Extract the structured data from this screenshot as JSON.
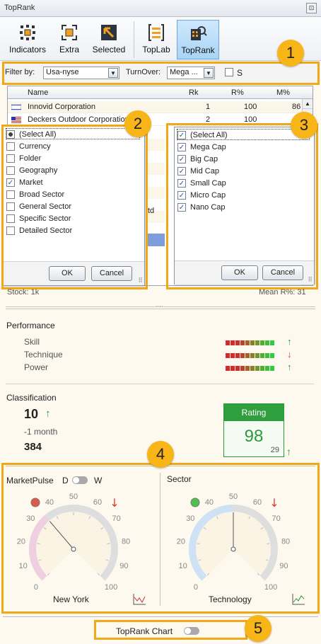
{
  "app_title": "TopRank",
  "pin_glyph": "⊡",
  "toolbar": {
    "items": [
      {
        "label": "Indicators",
        "icon": "indicators-icon"
      },
      {
        "label": "Extra",
        "icon": "extra-icon"
      },
      {
        "label": "Selected",
        "icon": "selected-icon"
      },
      {
        "label": "TopLab",
        "icon": "toplab-icon"
      },
      {
        "label": "TopRank",
        "icon": "toprank-icon",
        "active": true
      }
    ]
  },
  "filter": {
    "filter_by_label": "Filter by:",
    "filter_by_value": "Usa-nyse",
    "turnover_label": "TurnOver:",
    "turnover_value": "Mega ...",
    "s_label": "S"
  },
  "grid": {
    "headers": [
      "Name",
      "Rk",
      "R%",
      "M%"
    ],
    "rows": [
      {
        "name": "Innovid Corporation",
        "rk": "1",
        "r": "100",
        "m": "86"
      },
      {
        "name": "Deckers Outdoor Corporation",
        "rk": "2",
        "r": "100",
        "m": ""
      }
    ],
    "partial_text": "td"
  },
  "list_left": {
    "items": [
      {
        "label": "(Select All)",
        "state": "partial"
      },
      {
        "label": "Currency",
        "state": "off"
      },
      {
        "label": "Folder",
        "state": "off"
      },
      {
        "label": "Geography",
        "state": "off"
      },
      {
        "label": "Market",
        "state": "on"
      },
      {
        "label": "Broad Sector",
        "state": "off"
      },
      {
        "label": "General Sector",
        "state": "off"
      },
      {
        "label": "Specific Sector",
        "state": "off"
      },
      {
        "label": "Detailed Sector",
        "state": "off"
      }
    ],
    "ok": "OK",
    "cancel": "Cancel"
  },
  "list_right": {
    "items": [
      {
        "label": "(Select All)",
        "state": "on"
      },
      {
        "label": "Mega Cap",
        "state": "on"
      },
      {
        "label": "Big Cap",
        "state": "on"
      },
      {
        "label": "Mid Cap",
        "state": "on"
      },
      {
        "label": "Small Cap",
        "state": "on"
      },
      {
        "label": "Micro Cap",
        "state": "on"
      },
      {
        "label": "Nano Cap",
        "state": "on"
      }
    ],
    "ok": "OK",
    "cancel": "Cancel"
  },
  "stats": {
    "stock": "Stock: 1k",
    "mean": "Mean R%: 31"
  },
  "performance": {
    "title": "Performance",
    "rows": [
      {
        "label": "Skill",
        "trend": "up",
        "arrow": "↑"
      },
      {
        "label": "Technique",
        "trend": "down",
        "arrow": "↓"
      },
      {
        "label": "Power",
        "trend": "up",
        "arrow": "↑"
      }
    ],
    "bar_colors": [
      "#d42a2a",
      "#d42a2a",
      "#d42a2a",
      "#b8442a",
      "#a8602a",
      "#8f7b2a",
      "#6f962c",
      "#52ad32",
      "#3cbf3a",
      "#2fcc42"
    ]
  },
  "classification": {
    "title": "Classification",
    "rank": "10",
    "rank_arrow": "↑",
    "period": "-1 month",
    "total": "384"
  },
  "rating": {
    "label": "Rating",
    "value": "98",
    "sub": "29",
    "arrow": "↑"
  },
  "market_pulse": {
    "title": "MarketPulse",
    "toggle_left": "D",
    "toggle_right": "W",
    "light_color": "#e0584a",
    "arrow": "↓",
    "value": 35,
    "footer": "New York",
    "ticks": [
      "0",
      "10",
      "20",
      "30",
      "40",
      "50",
      "60",
      "70",
      "80",
      "90",
      "100"
    ]
  },
  "sector": {
    "title": "Sector",
    "light_color": "#4bc24b",
    "arrow": "↓",
    "value": 50,
    "footer": "Technology",
    "ticks": [
      "0",
      "10",
      "20",
      "30",
      "40",
      "50",
      "60",
      "70",
      "80",
      "90",
      "100"
    ]
  },
  "callouts": [
    "1",
    "2",
    "3",
    "4",
    "5"
  ],
  "footer": {
    "label": "TopRank Chart"
  }
}
